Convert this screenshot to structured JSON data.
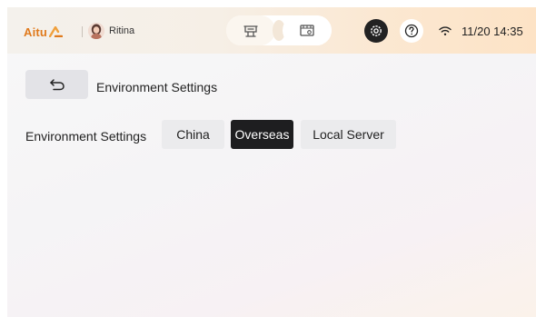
{
  "topbar": {
    "logo_text": "Aitu",
    "logo_icon": "aitu-logo-mark",
    "user_name": "Ritina",
    "mode_icons": [
      "print-mode-icon",
      "preview-mode-icon"
    ],
    "settings_icon": "gear-icon",
    "help_icon": "help-icon",
    "wifi_icon": "wifi-icon",
    "datetime": "11/20 14:35",
    "accent_color": "#e07a1c"
  },
  "page": {
    "back_icon": "back-arrow-icon",
    "title": "Environment Settings"
  },
  "environment": {
    "label": "Environment Settings",
    "options": [
      "China",
      "Overseas",
      "Local Server"
    ],
    "selected": "Overseas"
  }
}
